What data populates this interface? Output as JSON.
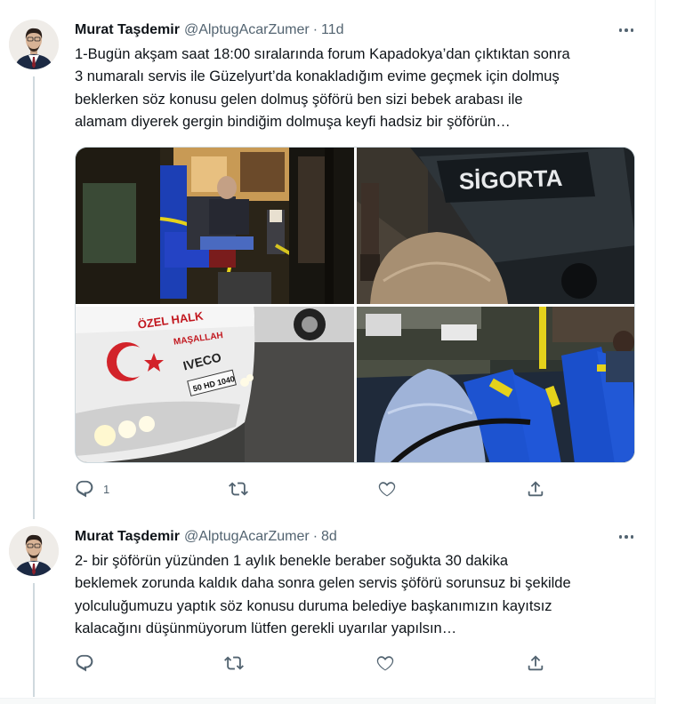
{
  "tweets": [
    {
      "author_name": "Murat Taşdemir",
      "handle": "@AlptugAcarZumer",
      "separator": "·",
      "time": "11d",
      "text": "1-Bugün akşam saat 18:00 sıralarında forum Kapadokya’dan çıktıktan sonra\n3 numaralı servis ile Güzelyurt’da konakladığım evime geçmek için dolmuş\nbeklerken söz konusu gelen dolmuş şöförü ben sizi bebek arabası ile\nalamam diyerek gergin bindiğim dolmuşa keyfi hadsiz bir şöförün…",
      "replies": "1",
      "photo_texts": {
        "bus_sign": "SİGORTA",
        "plate": "50 HD 1040",
        "brand": "IVECO",
        "ozel": "ÖZEL HALK",
        "masallah": "MAŞALLAH"
      }
    },
    {
      "author_name": "Murat Taşdemir",
      "handle": "@AlptugAcarZumer",
      "separator": "·",
      "time": "8d",
      "text": "2- bir şöförün yüzünden 1 aylık benekle beraber soğukta 30 dakika\nbeklemek zorunda kaldık daha sonra gelen servis şöförü sorunsuz bi şekilde\nyolculuğumuzu yaptık söz konusu duruma belediye başkanımızın kayıtsız\nkalacağını düşünmüyorum lütfen gerekli uyarılar yapılsın…"
    }
  ],
  "icons": [
    "reply-icon",
    "retweet-icon",
    "like-icon",
    "share-icon",
    "more-icon"
  ],
  "colors": {
    "secondary": "#536471",
    "line": "#cfd9de",
    "text": "#0f1419"
  }
}
